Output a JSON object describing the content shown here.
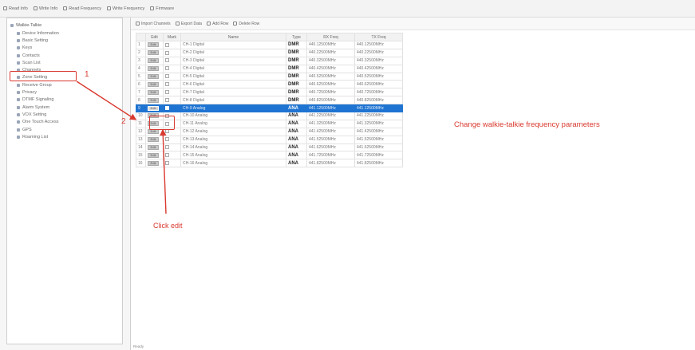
{
  "toolbar": {
    "buttons": [
      {
        "label": "Read Info",
        "icon": "read-icon"
      },
      {
        "label": "Write Info",
        "icon": "write-icon"
      },
      {
        "label": "Read Frequency",
        "icon": "read-frequency-icon"
      },
      {
        "label": "Write Frequency",
        "icon": "write-frequency-icon"
      },
      {
        "label": "Firmware",
        "icon": "firmware-icon"
      }
    ]
  },
  "tree": {
    "root": "Walkie-Talkie",
    "items": [
      "Device Information",
      "Basic Setting",
      "Keys",
      "Contacts",
      "Scan List",
      "Channels",
      "Zone Setting",
      "Receive Group",
      "Privacy",
      "DTMF Signaling",
      "Alarm System",
      "VOX Setting",
      "One Touch Access",
      "GPS",
      "Roaming List"
    ],
    "selected_index": 5
  },
  "sub_toolbar": {
    "buttons": [
      "Import Channels",
      "Export Data",
      "Add Row",
      "Delete Row"
    ]
  },
  "table": {
    "headers": [
      "",
      "Edit",
      "Mark",
      "Name",
      "Type",
      "RX Freq",
      "TX Freq"
    ],
    "edit_label": "Edit",
    "rows": [
      {
        "idx": "1",
        "name": "CH-1 Digital",
        "type": "DMR",
        "rx": "440.12500MHz",
        "tx": "440.12500MHz"
      },
      {
        "idx": "2",
        "name": "CH-2 Digital",
        "type": "DMR",
        "rx": "440.22500MHz",
        "tx": "440.22500MHz"
      },
      {
        "idx": "3",
        "name": "CH-3 Digital",
        "type": "DMR",
        "rx": "440.32500MHz",
        "tx": "440.32500MHz"
      },
      {
        "idx": "4",
        "name": "CH-4 Digital",
        "type": "DMR",
        "rx": "440.42500MHz",
        "tx": "440.42500MHz"
      },
      {
        "idx": "5",
        "name": "CH-5 Digital",
        "type": "DMR",
        "rx": "440.52500MHz",
        "tx": "440.52500MHz"
      },
      {
        "idx": "6",
        "name": "CH-6 Digital",
        "type": "DMR",
        "rx": "440.62500MHz",
        "tx": "440.62500MHz"
      },
      {
        "idx": "7",
        "name": "CH-7 Digital",
        "type": "DMR",
        "rx": "440.72500MHz",
        "tx": "440.72500MHz"
      },
      {
        "idx": "8",
        "name": "CH-8 Digital",
        "type": "DMR",
        "rx": "440.82500MHz",
        "tx": "440.82500MHz"
      },
      {
        "idx": "9",
        "name": "CH-9 Analog",
        "type": "ANA",
        "rx": "441.12500MHz",
        "tx": "441.12500MHz",
        "selected": true
      },
      {
        "idx": "10",
        "name": "CH-10 Analog",
        "type": "ANA",
        "rx": "441.22500MHz",
        "tx": "441.22500MHz"
      },
      {
        "idx": "11",
        "name": "CH-11 Analog",
        "type": "ANA",
        "rx": "441.32500MHz",
        "tx": "441.32500MHz"
      },
      {
        "idx": "12",
        "name": "CH-12 Analog",
        "type": "ANA",
        "rx": "441.42500MHz",
        "tx": "441.42500MHz"
      },
      {
        "idx": "13",
        "name": "CH-13 Analog",
        "type": "ANA",
        "rx": "441.52500MHz",
        "tx": "441.52500MHz"
      },
      {
        "idx": "14",
        "name": "CH-14 Analog",
        "type": "ANA",
        "rx": "441.62500MHz",
        "tx": "441.62500MHz"
      },
      {
        "idx": "15",
        "name": "CH-15 Analog",
        "type": "ANA",
        "rx": "441.72500MHz",
        "tx": "441.72500MHz"
      },
      {
        "idx": "16",
        "name": "CH-16 Analog",
        "type": "ANA",
        "rx": "441.82500MHz",
        "tx": "441.82500MHz"
      }
    ]
  },
  "status_bar": "Ready",
  "annotations": {
    "step1": "1",
    "step2": "2",
    "click_edit": "Click edit",
    "change_note": "Change walkie-talkie frequency parameters",
    "color": "#d93a30"
  },
  "colors": {
    "selection": "#1f74d2",
    "annotation": "#d93a30"
  }
}
